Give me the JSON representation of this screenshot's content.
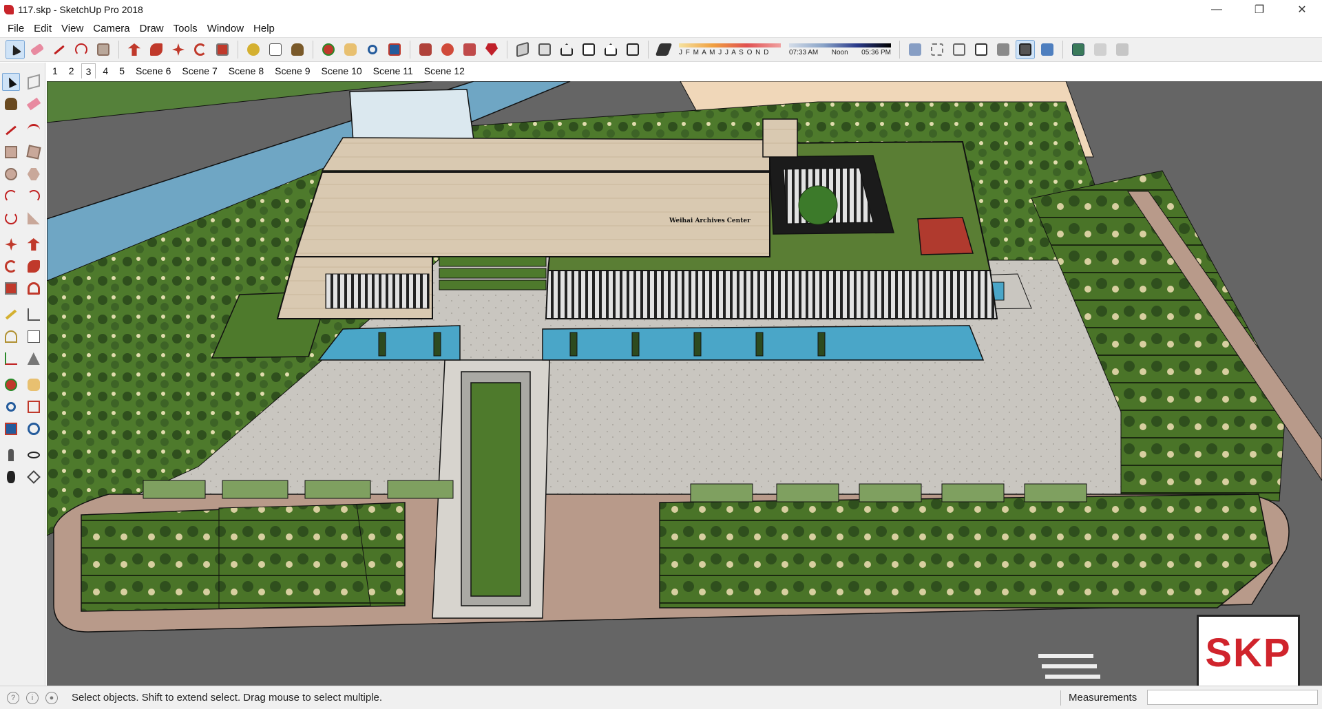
{
  "window": {
    "title": "117.skp - SketchUp Pro 2018",
    "controls": {
      "minimize": "—",
      "restore": "❐",
      "close": "✕"
    }
  },
  "menu": [
    "File",
    "Edit",
    "View",
    "Camera",
    "Draw",
    "Tools",
    "Window",
    "Help"
  ],
  "toolbar": {
    "shadow_months": "J F M A M J J A S O N D",
    "time_start": "07:33 AM",
    "time_mid": "Noon",
    "time_end": "05:36 PM"
  },
  "scenes": {
    "active_index": 2,
    "tabs": [
      "1",
      "2",
      "3",
      "4",
      "5",
      "Scene 6",
      "Scene 7",
      "Scene 8",
      "Scene 9",
      "Scene 10",
      "Scene 11",
      "Scene 12"
    ]
  },
  "model": {
    "building_sign": "Weihai Archives Center"
  },
  "badge": {
    "text": "SKP",
    "color": "#d0242c"
  },
  "statusbar": {
    "hint": "Select objects. Shift to extend select. Drag mouse to select multiple.",
    "measurements_label": "Measurements",
    "measurements_value": ""
  },
  "colors": {
    "grass": "#4e7a2c",
    "water": "#4aa6c8",
    "facade": "#d9c9b1",
    "road": "#6a6a6a",
    "plaza": "#c9c6c0",
    "red_block": "#b03a2e"
  }
}
